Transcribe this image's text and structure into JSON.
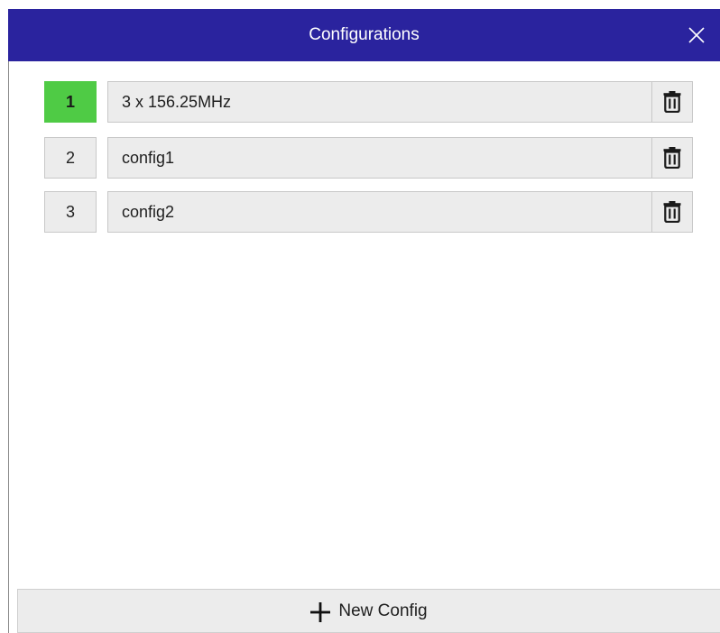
{
  "dialog": {
    "title": "Configurations",
    "close_icon": "close-icon"
  },
  "configs": [
    {
      "number": "1",
      "name": "3 x 156.25MHz",
      "active": true
    },
    {
      "number": "2",
      "name": "config1",
      "active": false
    },
    {
      "number": "3",
      "name": "config2",
      "active": false
    }
  ],
  "footer": {
    "new_config_label": "New Config",
    "new_config_icon": "plus-icon"
  },
  "colors": {
    "titlebar": "#2a239e",
    "active_number": "#4fcb45",
    "row_background": "#ececec"
  }
}
